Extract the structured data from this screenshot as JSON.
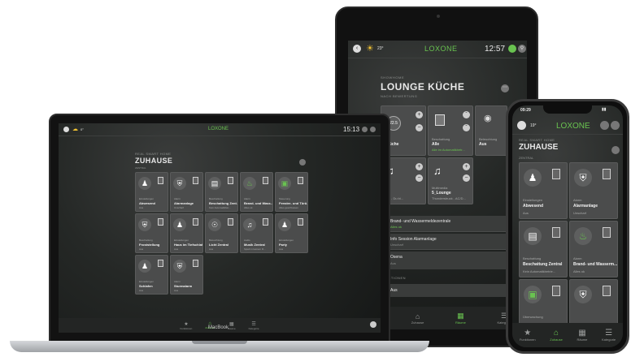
{
  "macbook": {
    "label": "MacBook",
    "status": {
      "temp": "0°",
      "logo": "LOXONE",
      "time": "15:13"
    },
    "kicker": "REAL SMART HOME",
    "title": "ZUHAUSE",
    "sub": "ZENTRAL",
    "tiles": [
      {
        "cat": "Einstellungen",
        "name": "Abwesend",
        "state": "Aus"
      },
      {
        "cat": "Alarm",
        "name": "Alarmanlage",
        "state": "Unscharf"
      },
      {
        "cat": "Beschattung",
        "name": "Beschattung Zent...",
        "state": "Kein Automatikbet..."
      },
      {
        "cat": "Alarm",
        "name": "Brand- und Wass...",
        "state": "Alles ok"
      },
      {
        "cat": "Steuerung",
        "name": "Fenster- und Türü...",
        "state": "Alles geschlossen"
      },
      {
        "cat": "Beschattung",
        "name": "Froststellung",
        "state": "Aus"
      },
      {
        "cat": "Einstellungen",
        "name": "Haus im Tiefschlaf",
        "state": "Aus"
      },
      {
        "cat": "Beleuchtung",
        "name": "Licht Zentral",
        "state": "Aus"
      },
      {
        "cat": "Audio",
        "name": "Musik Zentral",
        "state": "Spielt in keinem R..."
      },
      {
        "cat": "Einstellungen",
        "name": "Party",
        "state": "Aus"
      },
      {
        "cat": "Einstellungen",
        "name": "Schlafen",
        "state": "Aus"
      },
      {
        "cat": "Alarm",
        "name": "Sturmalarm",
        "state": "Aus"
      }
    ],
    "tabs": [
      "Funktionen",
      "Zuhause",
      "Räume",
      "Kategorie"
    ]
  },
  "ipad": {
    "status": {
      "temp": "23°",
      "logo": "LOXONE",
      "time": "12:57"
    },
    "kicker": "SHOWHOME",
    "title": "LOUNGE KÜCHE",
    "sub": "NACH BEWERTUNG",
    "tiles": [
      {
        "value": "22.5",
        "cat": "",
        "name": "e Küche",
        "state": ""
      },
      {
        "value": "",
        "cat": "Beschattung",
        "name": "Alle",
        "state": "Alle im Automatikbetr..."
      },
      {
        "value": "",
        "cat": "Beleuchtung",
        "name": "Aus",
        "state": ""
      },
      {
        "value": "",
        "cat": "",
        "name": "che",
        "state": "ngen - Du bi..."
      },
      {
        "value": "",
        "cat": "Multimedia",
        "name": "5_Lounge",
        "state": "Thunderstruck - AC/D..."
      }
    ],
    "list": [
      {
        "name": "Brand- und Wassermeldezentrale",
        "state": "Alles ok"
      },
      {
        "name": "Info Session Alarmanlage",
        "state": "Unscharf"
      },
      {
        "name": "Osena",
        "state": "Aus"
      }
    ],
    "section2": "FUNKTIONEN",
    "row_last": "Aus",
    "tabs": [
      "Funktionen",
      "Zuhause",
      "Räume",
      "Kategorie"
    ]
  },
  "iphone": {
    "status": {
      "time": "09:29",
      "temp": "19°",
      "logo": "LOXONE"
    },
    "kicker": "REAL SMART HOME",
    "title": "ZUHAUSE",
    "sub": "ZENTRAL",
    "tiles": [
      {
        "cat": "Einstellungen",
        "name": "Abwesend",
        "state": "Aus"
      },
      {
        "cat": "Alarm",
        "name": "Alarmanlage",
        "state": "Unscharf"
      },
      {
        "cat": "Beschattung",
        "name": "Beschattung Zentral",
        "state": "Kein Automatikbetrie..."
      },
      {
        "cat": "Alarm",
        "name": "Brand- und Wasserm...",
        "state": "Alles ok"
      },
      {
        "cat": "Überwachung",
        "name": "",
        "state": ""
      },
      {
        "cat": "",
        "name": "",
        "state": ""
      }
    ],
    "tabs": [
      "Funktionen",
      "Zuhause",
      "Räume",
      "Kategorie"
    ]
  }
}
